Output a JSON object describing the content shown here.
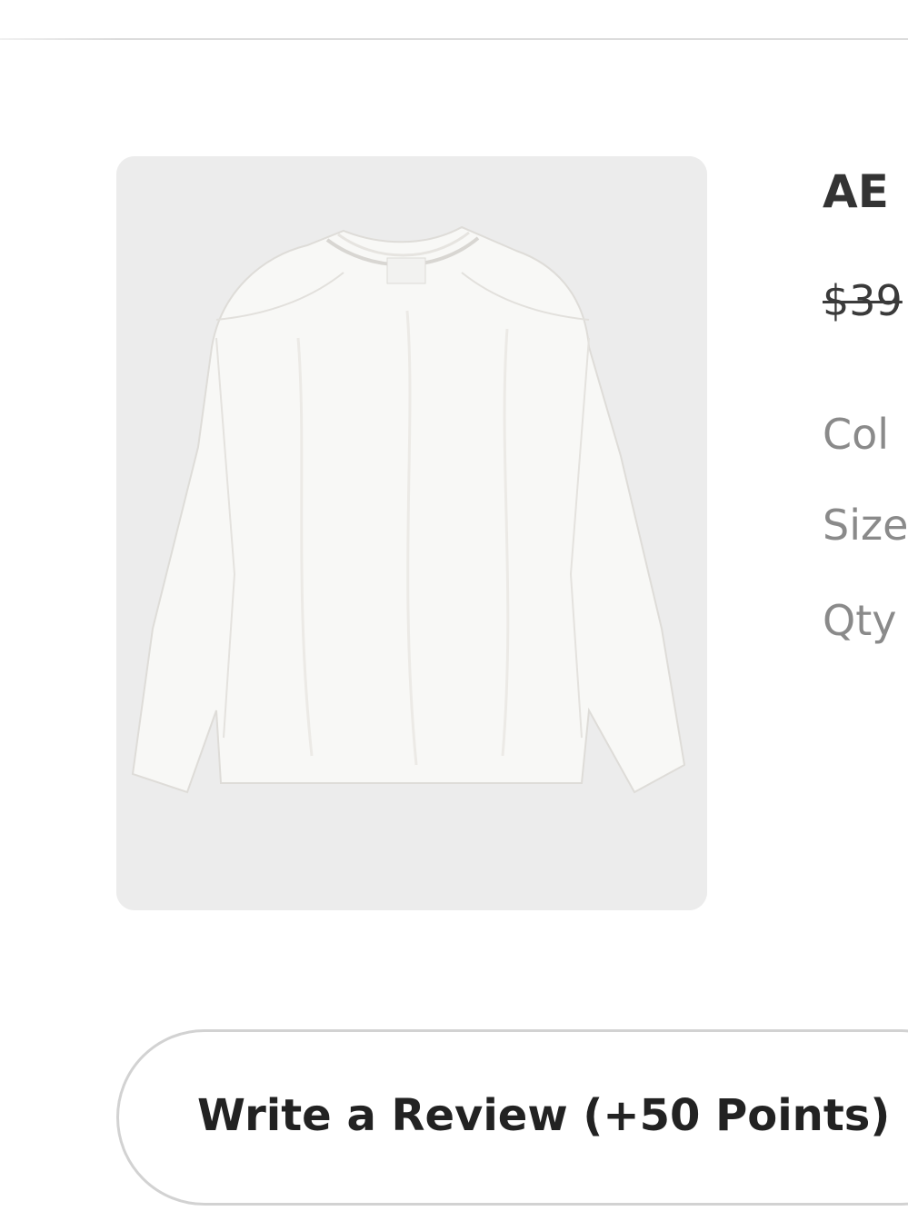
{
  "product": {
    "image_alt": "white long-sleeve t-shirt",
    "name": "AE",
    "price": "$39",
    "color_label": "Col",
    "size_label": "Size",
    "qty_label": "Qty"
  },
  "review": {
    "button_label": "Write a Review (+50 Points)"
  }
}
